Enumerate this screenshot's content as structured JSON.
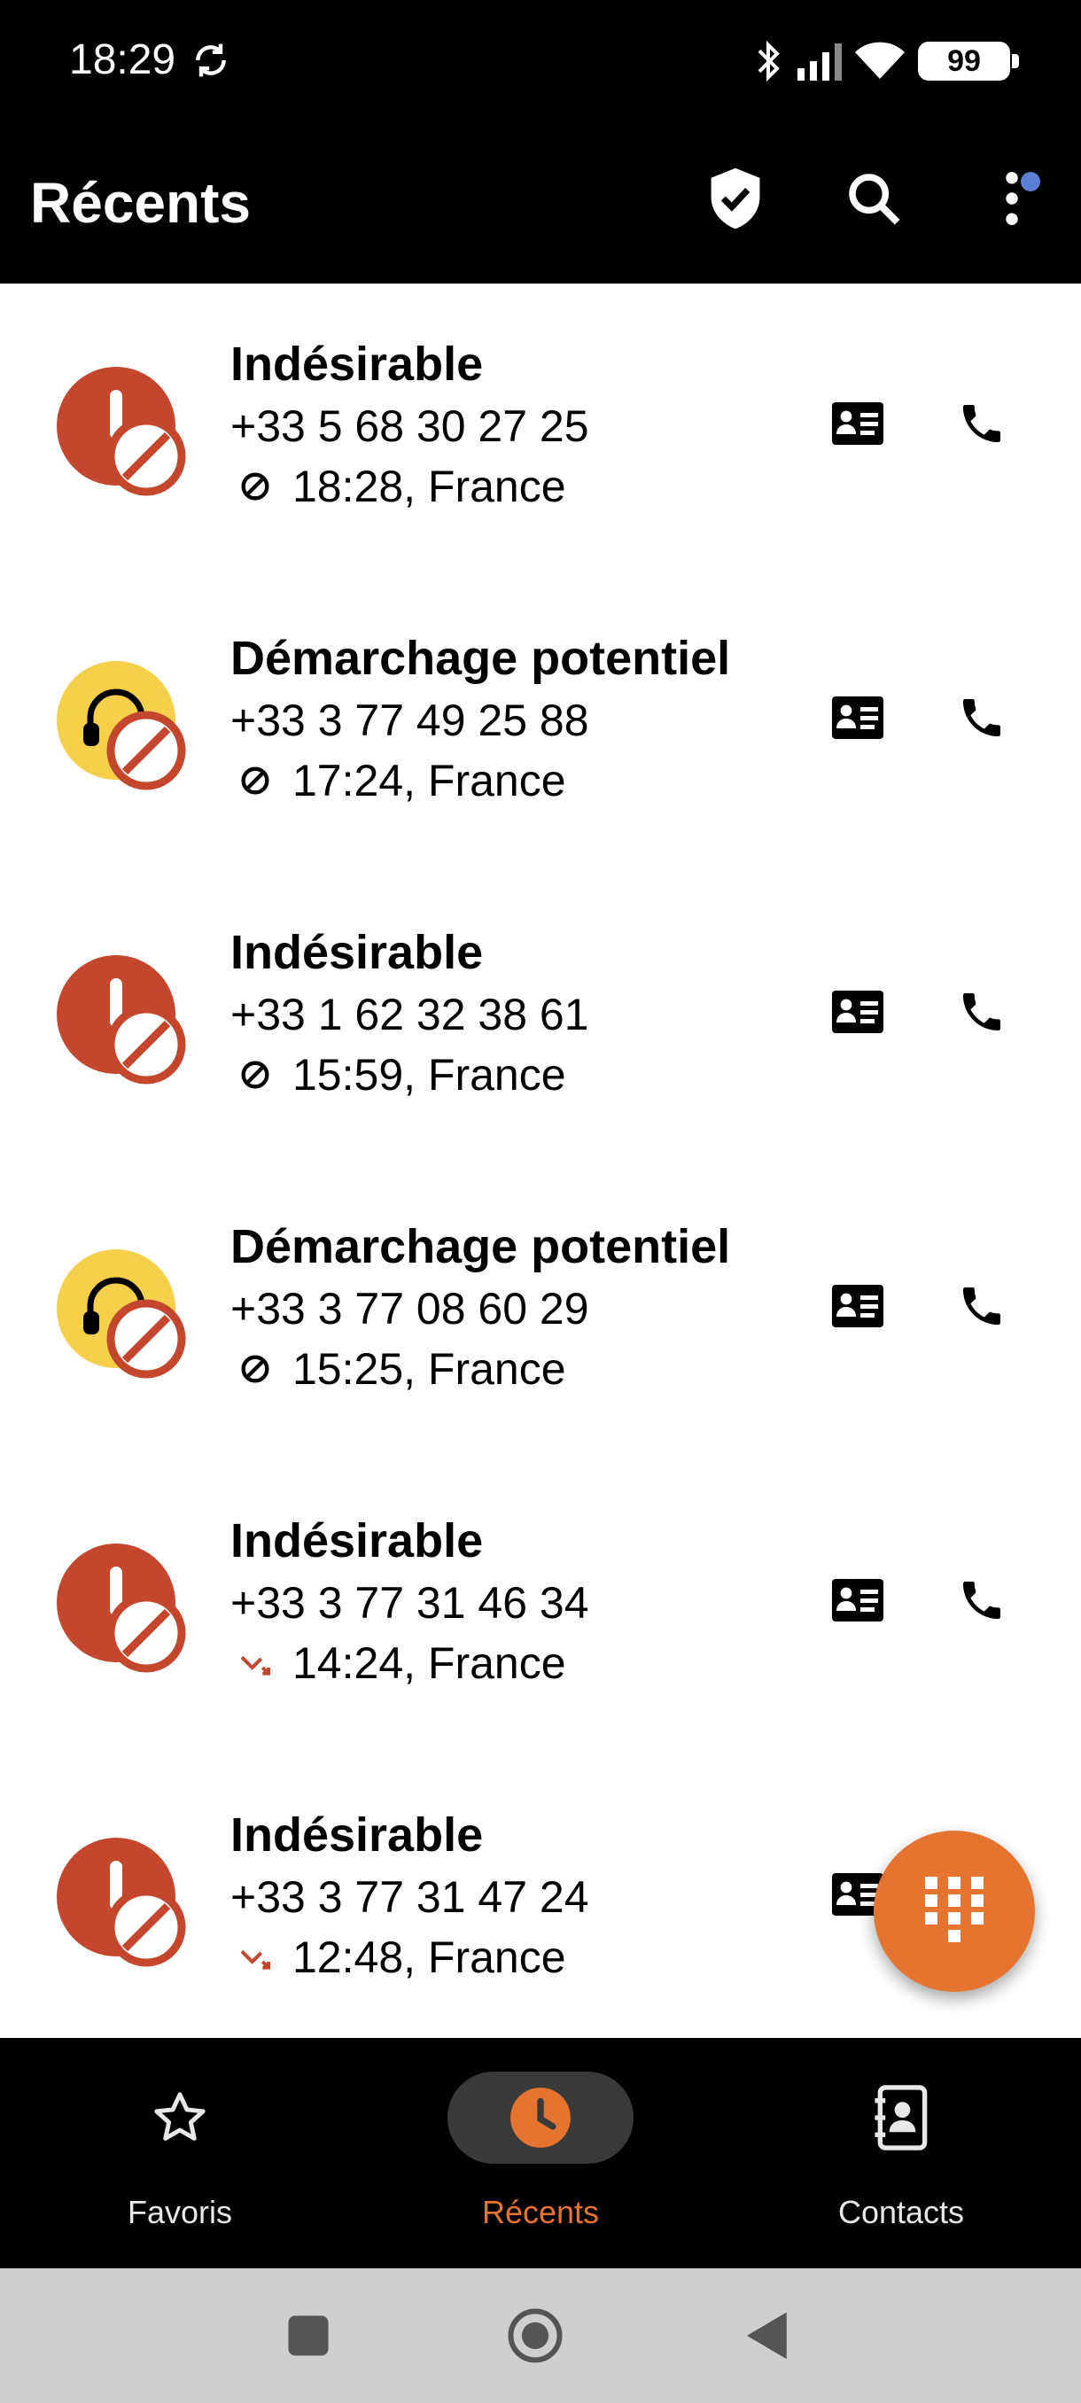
{
  "status_bar": {
    "time": "18:29",
    "battery": "99",
    "icons": [
      "sync-icon",
      "bluetooth-icon",
      "signal-icon",
      "wifi-icon",
      "battery-icon"
    ]
  },
  "app_bar": {
    "title": "Récents",
    "icons": [
      "shield-check-icon",
      "search-icon",
      "more-vert-icon"
    ]
  },
  "calls": [
    {
      "label": "Indésirable",
      "number": "+33 5 68 30 27 25",
      "time_location": "18:28, France",
      "avatar_type": "spam",
      "status_icon": "blocked-icon"
    },
    {
      "label": "Démarchage potentiel",
      "number": "+33 3 77 49 25 88",
      "time_location": "17:24, France",
      "avatar_type": "telemarketing",
      "status_icon": "blocked-icon"
    },
    {
      "label": "Indésirable",
      "number": "+33 1 62 32 38 61",
      "time_location": "15:59, France",
      "avatar_type": "spam",
      "status_icon": "blocked-icon"
    },
    {
      "label": "Démarchage potentiel",
      "number": "+33 3 77 08 60 29",
      "time_location": "15:25, France",
      "avatar_type": "telemarketing",
      "status_icon": "blocked-icon"
    },
    {
      "label": "Indésirable",
      "number": "+33 3 77 31 46 34",
      "time_location": "14:24, France",
      "avatar_type": "spam",
      "status_icon": "missed-call-icon"
    },
    {
      "label": "Indésirable",
      "number": "+33 3 77 31 47 24",
      "time_location": "12:48, France",
      "avatar_type": "spam",
      "status_icon": "missed-call-icon"
    }
  ],
  "bottom_nav": {
    "items": [
      {
        "label": "Favoris",
        "icon": "star-icon",
        "active": false
      },
      {
        "label": "Récents",
        "icon": "clock-icon",
        "active": true
      },
      {
        "label": "Contacts",
        "icon": "contacts-book-icon",
        "active": false
      }
    ]
  },
  "colors": {
    "accent": "#e57430",
    "spam_red": "#c4472d",
    "telemarketing_yellow": "#f7d04b",
    "bar_black": "#000000"
  }
}
